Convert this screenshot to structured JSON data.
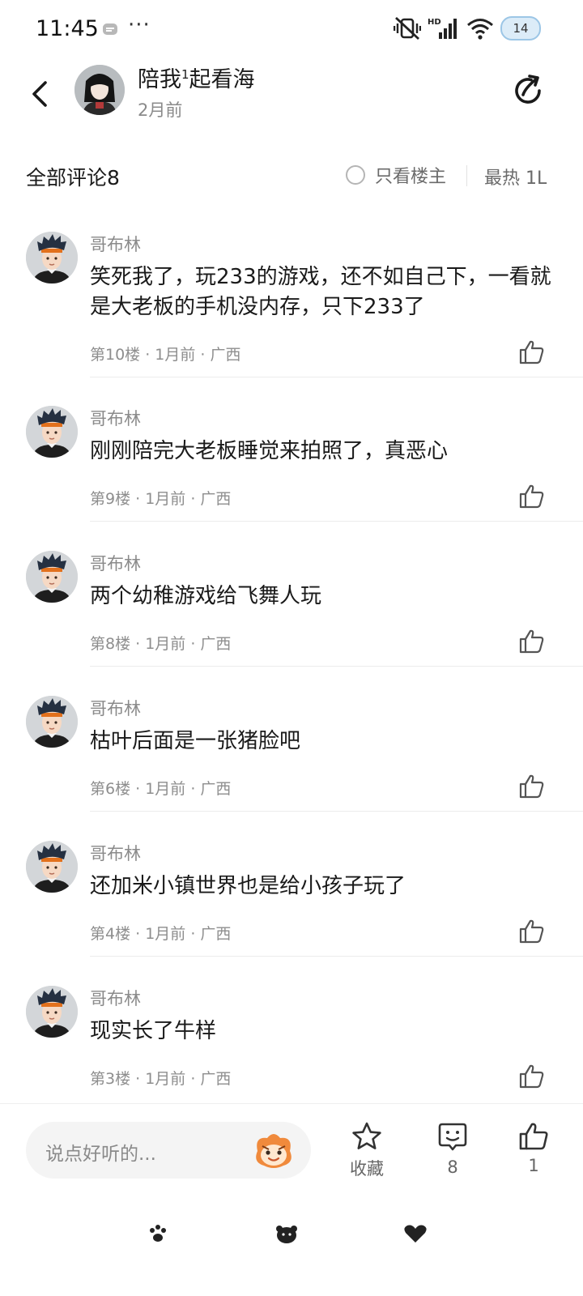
{
  "status_bar": {
    "time": "11:45",
    "dots": "···",
    "battery": "14",
    "hd_label": "HD"
  },
  "header": {
    "author": "陪我",
    "author_sup": "1",
    "author_rest": "起看海",
    "time": "2月前"
  },
  "comments_header": {
    "title": "全部评论8",
    "only_owner": "只看楼主",
    "sort": "最热 1L"
  },
  "comments": [
    {
      "user": "哥布林",
      "text": "笑死我了，玩233的游戏，还不如自己下，一看就是大老板的手机没内存，只下233了",
      "meta": "第10楼 · 1月前 · 广西"
    },
    {
      "user": "哥布林",
      "text": "刚刚陪完大老板睡觉来拍照了，真恶心",
      "meta": "第9楼 · 1月前 · 广西"
    },
    {
      "user": "哥布林",
      "text": "两个幼稚游戏给飞舞人玩",
      "meta": "第8楼 · 1月前 · 广西"
    },
    {
      "user": "哥布林",
      "text": "枯叶后面是一张猪脸吧",
      "meta": "第6楼 · 1月前 · 广西"
    },
    {
      "user": "哥布林",
      "text": "还加米小镇世界也是给小孩子玩了",
      "meta": "第4楼 · 1月前 · 广西"
    },
    {
      "user": "哥布林",
      "text": "现实长了牛样",
      "meta": "第3楼 · 1月前 · 广西"
    }
  ],
  "bottom_bar": {
    "input_placeholder": "说点好听的...",
    "collect_label": "收藏",
    "comment_count": "8",
    "like_count": "1"
  },
  "colors": {
    "text": "#1a1a1a",
    "muted": "#8a8a8a",
    "divider": "#ececec",
    "mascot": "#f08a3c"
  }
}
